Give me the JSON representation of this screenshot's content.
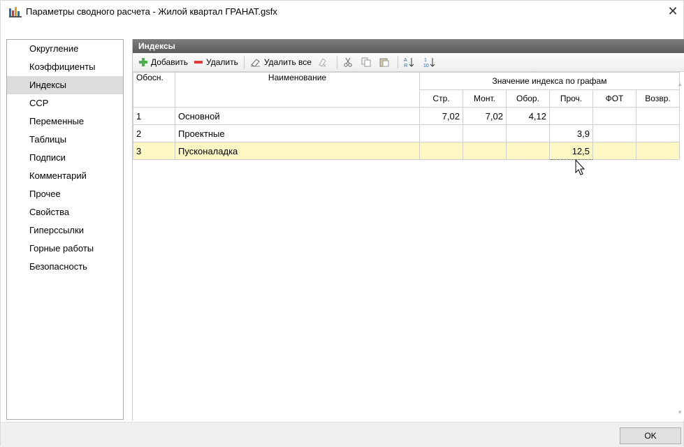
{
  "window": {
    "title": "Параметры сводного расчета - Жилой квартал ГРАНАТ.gsfx"
  },
  "sidebar": {
    "items": [
      {
        "label": "Округление"
      },
      {
        "label": "Коэффициенты"
      },
      {
        "label": "Индексы",
        "selected": true
      },
      {
        "label": "ССР"
      },
      {
        "label": "Переменные"
      },
      {
        "label": "Таблицы"
      },
      {
        "label": "Подписи"
      },
      {
        "label": "Комментарий"
      },
      {
        "label": "Прочее"
      },
      {
        "label": "Свойства"
      },
      {
        "label": "Гиперссылки"
      },
      {
        "label": "Горные работы"
      },
      {
        "label": "Безопасность"
      }
    ]
  },
  "panel": {
    "title": "Индексы"
  },
  "toolbar": {
    "add_label": "Добавить",
    "delete_label": "Удалить",
    "delete_all_label": "Удалить все"
  },
  "table": {
    "headers": {
      "basis": "Обосн.",
      "name": "Наименование",
      "group": "Значение индекса по графам",
      "cols": [
        "Стр.",
        "Монт.",
        "Обор.",
        "Проч.",
        "ФОТ",
        "Возвр."
      ]
    },
    "rows": [
      {
        "basis": "1",
        "name": "Основной",
        "vals": [
          "7,02",
          "7,02",
          "4,12",
          "",
          "",
          ""
        ]
      },
      {
        "basis": "2",
        "name": "Проектные",
        "vals": [
          "",
          "",
          "",
          "3,9",
          "",
          ""
        ]
      },
      {
        "basis": "3",
        "name": "Пусконаладка",
        "vals": [
          "",
          "",
          "",
          "12,5",
          "",
          ""
        ],
        "selected": true
      }
    ]
  },
  "footer": {
    "ok_label": "OK"
  },
  "colors": {
    "selected_row": "#fdf8c4",
    "panel_header": "#6b6b6b",
    "sidebar_selected": "#dcdcdc"
  }
}
